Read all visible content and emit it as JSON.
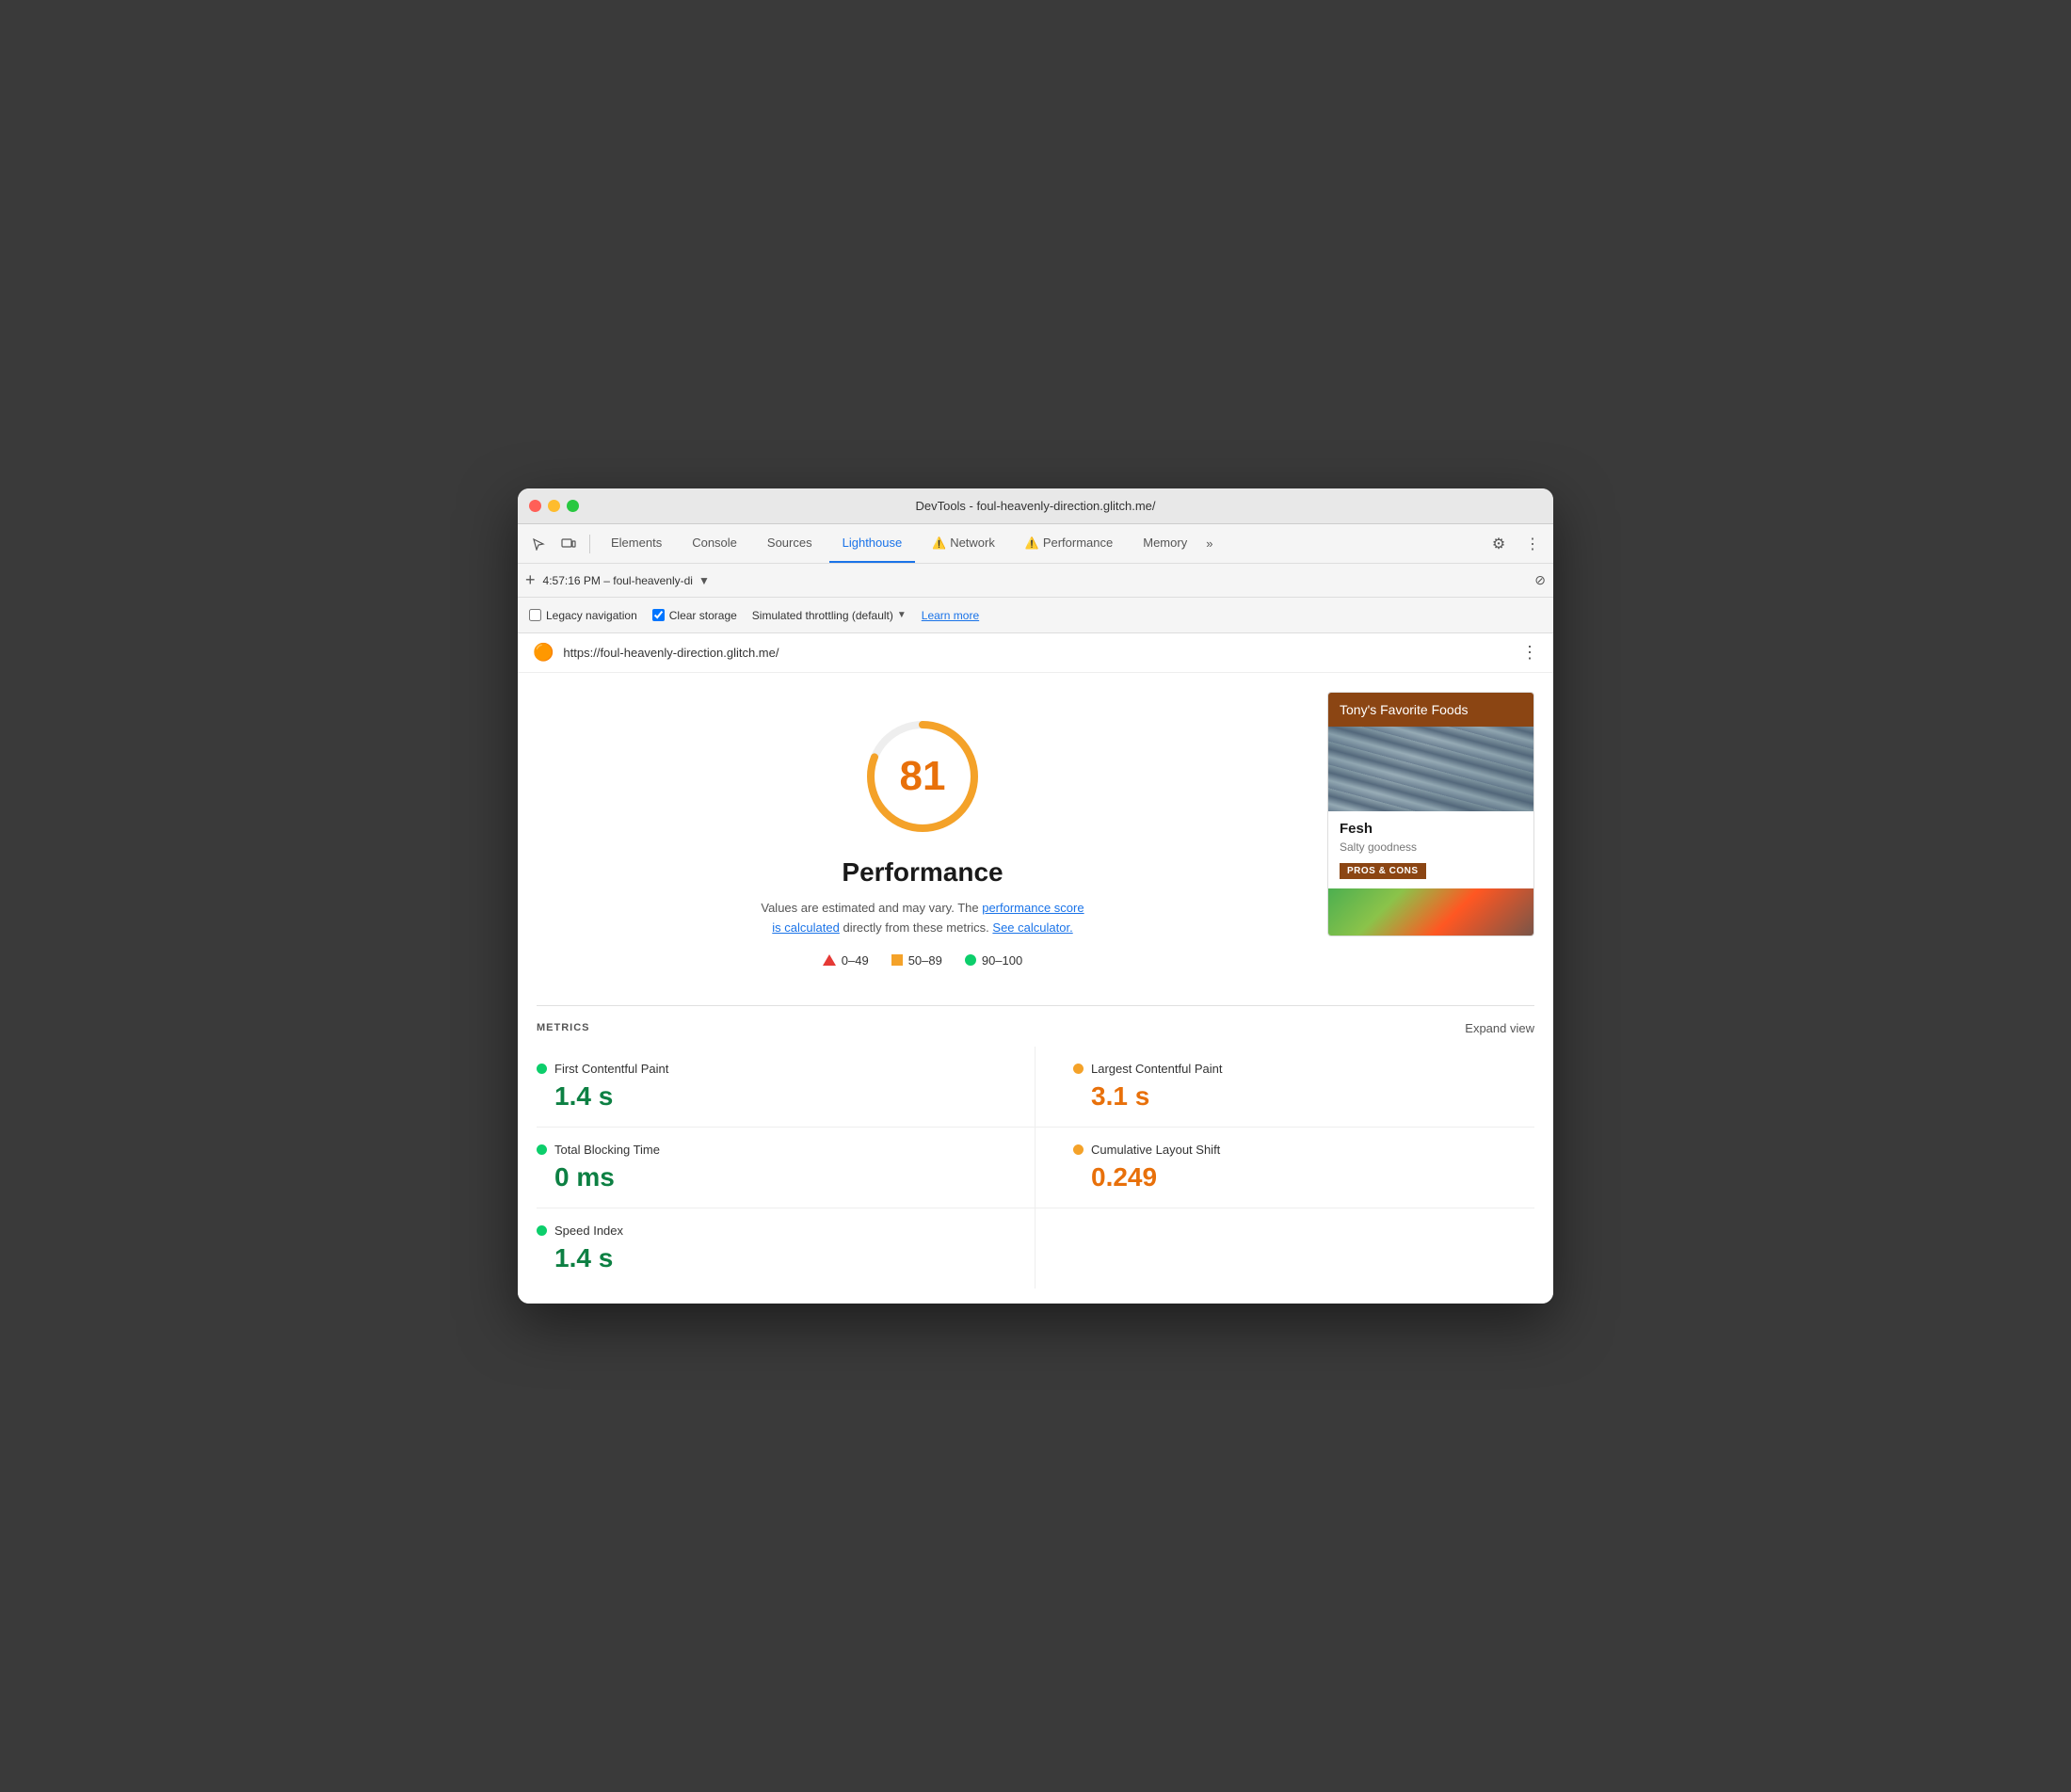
{
  "window": {
    "title": "DevTools - foul-heavenly-direction.glitch.me/"
  },
  "tabs": [
    {
      "id": "elements",
      "label": "Elements",
      "active": false,
      "warning": false
    },
    {
      "id": "console",
      "label": "Console",
      "active": false,
      "warning": false
    },
    {
      "id": "sources",
      "label": "Sources",
      "active": false,
      "warning": false
    },
    {
      "id": "lighthouse",
      "label": "Lighthouse",
      "active": true,
      "warning": false
    },
    {
      "id": "network",
      "label": "Network",
      "active": false,
      "warning": true
    },
    {
      "id": "performance",
      "label": "Performance",
      "active": false,
      "warning": true
    },
    {
      "id": "memory",
      "label": "Memory",
      "active": false,
      "warning": false
    }
  ],
  "urlbar": {
    "timestamp": "4:57:16 PM – foul-heavenly-di",
    "dropdown_label": "▼",
    "block_icon": "⊘"
  },
  "options": {
    "legacy_navigation_label": "Legacy navigation",
    "legacy_navigation_checked": false,
    "clear_storage_label": "Clear storage",
    "clear_storage_checked": true,
    "simulated_throttling_label": "Simulated throttling (default)",
    "learn_more_label": "Learn more"
  },
  "url_display": {
    "url": "https://foul-heavenly-direction.glitch.me/"
  },
  "score_section": {
    "score": "81",
    "label": "Performance",
    "description_text": "Values are estimated and may vary. The",
    "performance_score_link": "performance score\nis calculated",
    "description_mid": "directly from these metrics.",
    "calculator_link": "See calculator.",
    "legend": [
      {
        "type": "triangle",
        "range": "0–49"
      },
      {
        "type": "square",
        "range": "50–89"
      },
      {
        "type": "circle",
        "range": "90–100"
      }
    ]
  },
  "preview": {
    "header": "Tony's Favorite Foods",
    "item_title": "Fesh",
    "item_subtitle": "Salty goodness",
    "pros_cons_button": "PROS & CONS"
  },
  "metrics": {
    "section_title": "METRICS",
    "expand_label": "Expand view",
    "items": [
      {
        "id": "fcp",
        "name": "First Contentful Paint",
        "value": "1.4 s",
        "color": "green"
      },
      {
        "id": "lcp",
        "name": "Largest Contentful Paint",
        "value": "3.1 s",
        "color": "orange"
      },
      {
        "id": "tbt",
        "name": "Total Blocking Time",
        "value": "0 ms",
        "color": "green"
      },
      {
        "id": "cls",
        "name": "Cumulative Layout Shift",
        "value": "0.249",
        "color": "orange"
      },
      {
        "id": "si",
        "name": "Speed Index",
        "value": "1.4 s",
        "color": "green"
      }
    ]
  },
  "colors": {
    "accent_blue": "#1a73e8",
    "green": "#0cce6b",
    "orange": "#f4a229",
    "red": "#e53935",
    "score_color": "#e8700a",
    "preview_header_bg": "#8b4513"
  }
}
